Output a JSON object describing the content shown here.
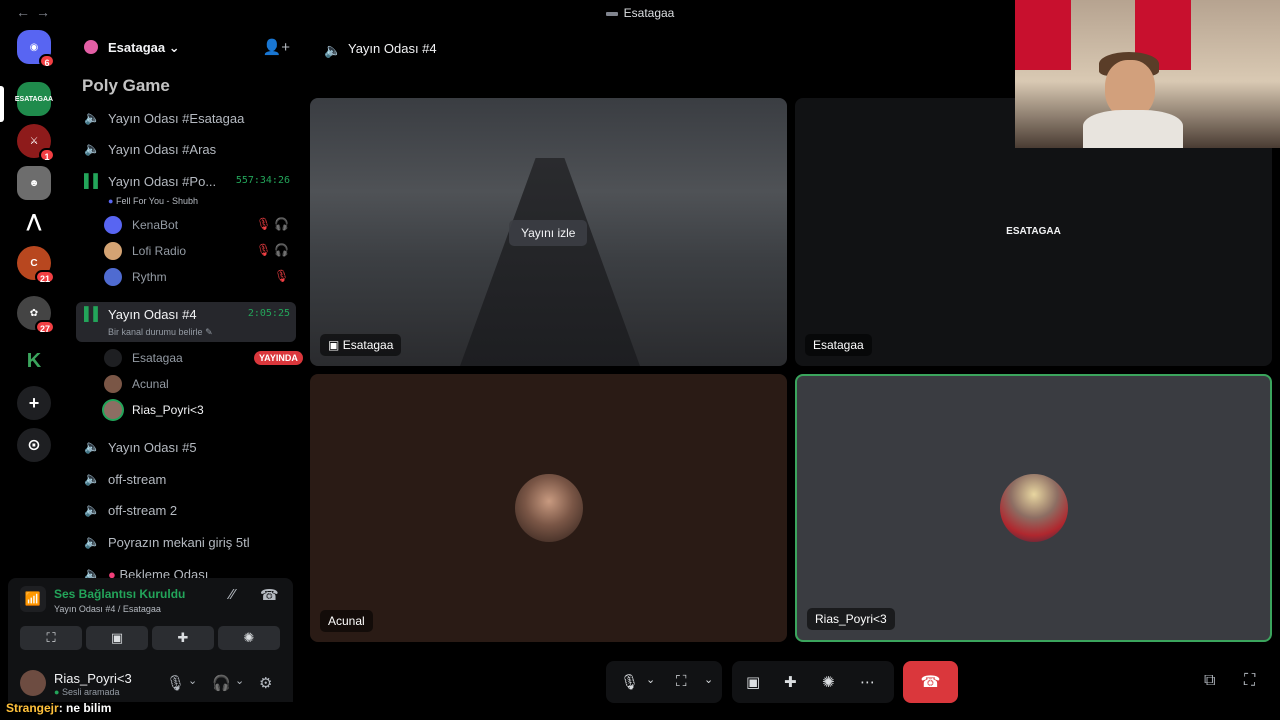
{
  "window": {
    "title": "Esatagaa",
    "back": "←",
    "forward": "→"
  },
  "rail": {
    "servers": [
      {
        "label": "◉",
        "badge": "6",
        "color": "#5865f2"
      },
      {
        "label": "ESATAGAA",
        "badge": "",
        "color": "#1f8b4c"
      },
      {
        "label": "⚔",
        "badge": "1",
        "color": "#8e1b1b"
      },
      {
        "label": "☻",
        "badge": "",
        "color": "#6d6d6d"
      },
      {
        "label": "⋀",
        "badge": "",
        "color": "#000000"
      },
      {
        "label": "C",
        "badge": "21",
        "color": "#b8471f"
      },
      {
        "label": "✿",
        "badge": "27",
        "color": "#444444"
      },
      {
        "label": "K",
        "badge": "",
        "color": "#000000"
      },
      {
        "label": "+",
        "badge": "",
        "color": "#1e1f22"
      },
      {
        "label": "⊙",
        "badge": "",
        "color": "#1e1f22"
      }
    ]
  },
  "guild": {
    "name": "Esatagaa",
    "dropdown": "⌄",
    "invite_icon": "👤+"
  },
  "channels": {
    "overlay_banner": "Poly Game",
    "c1": "Yayın Odası #Esatagaa",
    "c2": "Yayın Odası #Aras",
    "c3": "Yayın Odası #Po...",
    "c3_timer": "557:34:26",
    "c3_status": "Fell For You - Shubh",
    "c3_users": [
      {
        "name": "KenaBot"
      },
      {
        "name": "Lofi Radio"
      },
      {
        "name": "Rythm"
      }
    ],
    "c4": "Yayın Odası #4",
    "c4_timer": "2:05:25",
    "c4_status": "Bir kanal durumu belirle",
    "c4_users": [
      {
        "name": "Esatagaa",
        "live": "YAYINDA"
      },
      {
        "name": "Acunal"
      },
      {
        "name": "Rias_Poyri<3"
      }
    ],
    "c5": "Yayın Odası #5",
    "c6": "off-stream",
    "c7": "off-stream 2",
    "c8": "Poyrazın mekani giriş 5tl",
    "c9": "Bekleme Odası"
  },
  "voice": {
    "title": "Ses Bağlantısı Kuruldu",
    "subtitle": "Yayın Odası #4 / Esatagaa"
  },
  "user": {
    "name": "Rias_Poyri<3",
    "status": "Sesli aramada"
  },
  "chat_overlay": {
    "name": "Strangejr",
    "message": ": ne bilim"
  },
  "stage": {
    "header": "Yayın Odası #4",
    "tiles": [
      {
        "name": "Esatagaa",
        "overlay": "Yayını izle"
      },
      {
        "name": "Esatagaa",
        "center": "ESATAGAA"
      },
      {
        "name": "Acunal"
      },
      {
        "name": "Rias_Poyri<3"
      }
    ]
  },
  "colors": {
    "accent_green": "#23a55a",
    "danger": "#da373c",
    "brand": "#5865f2"
  }
}
